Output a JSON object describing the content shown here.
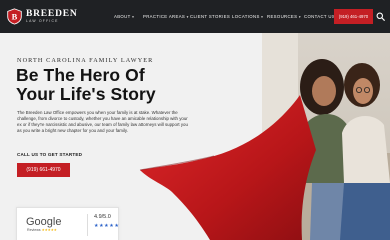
{
  "brand": {
    "name": "BREEDEN",
    "tagline": "LAW OFFICE",
    "colors": {
      "accent": "#c41f24",
      "nav_bg": "#1f2124",
      "page_bg": "#f1f1f1"
    }
  },
  "nav": {
    "items": [
      {
        "label": "ABOUT",
        "dropdown": true
      },
      {
        "label": "PRACTICE AREAS",
        "dropdown": true
      },
      {
        "label": "CLIENT STORIES",
        "dropdown": false
      },
      {
        "label": "LOCATIONS",
        "dropdown": true
      },
      {
        "label": "RESOURCES",
        "dropdown": true
      },
      {
        "label": "CONTACT US",
        "dropdown": false
      }
    ],
    "caret": "▾",
    "phone_button": "(919) 461-4970",
    "search_icon": "search-icon"
  },
  "hero": {
    "eyebrow": "NORTH CAROLINA FAMILY LAWYER",
    "headline_line1": "Be The Hero Of",
    "headline_line2": "Your Life's Story",
    "body": "The Breeden Law Office empowers you when your family is at stake. Whatever the challenge, from divorce to custody, whether you have an amicable relationship with your ex or if they're narcissistic and abusive, our team of family law attorneys will support you as you write a bright new chapter for you and your family.",
    "call_label": "CALL US TO GET STARTED",
    "phone_button": "(919) 661-4970"
  },
  "review": {
    "provider": "Google",
    "provider_sub": "Reviews",
    "sub_stars": "★★★★★",
    "score": "4.9/5.0",
    "stars": "★★★★★"
  }
}
